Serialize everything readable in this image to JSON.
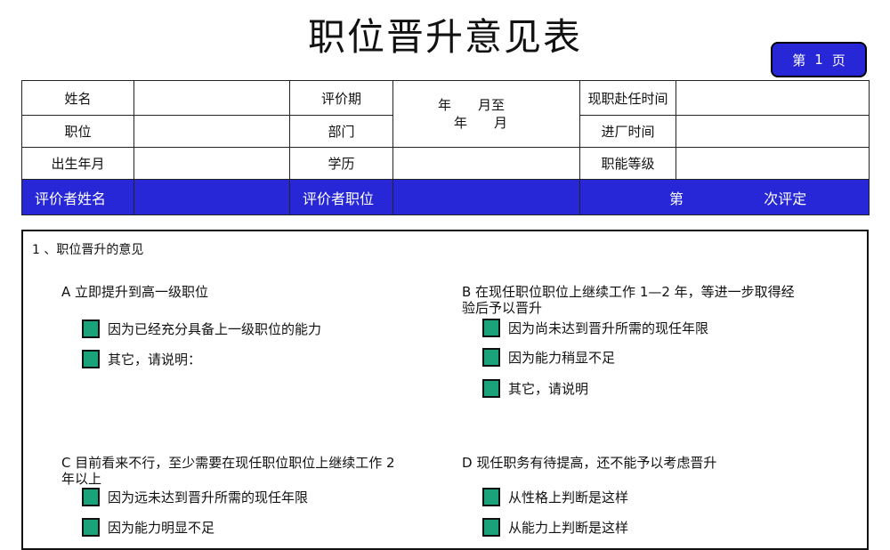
{
  "title": "职位晋升意见表",
  "page": {
    "prefix": "第",
    "number": "1",
    "suffix": "页"
  },
  "info": {
    "name_label": "姓名",
    "period_label": "评价期",
    "period_line1": "年　　月至",
    "period_line2": "年　　月",
    "current_since_label": "现职赴任时间",
    "position_label": "职位",
    "dept_label": "部门",
    "join_label": "进厂时间",
    "birth_label": "出生年月",
    "edu_label": "学历",
    "grade_label": "职能等级",
    "evaluator_name_label": "评价者姓名",
    "evaluator_pos_label": "评价者职位",
    "round_prefix": "第",
    "round_suffix": "次评定"
  },
  "section1": {
    "title": "1 、职位晋升的意见",
    "A": {
      "head": "A  立即提升到高一级职位",
      "items": [
        "因为已经充分具备上一级职位的能力",
        "其它，请说明："
      ]
    },
    "B": {
      "head_line1": "B  在现任职位职位上继续工作 1—2 年，等进一步取得经",
      "head_line2": "验后予以晋升",
      "items": [
        "因为尚未达到晋升所需的现任年限",
        "因为能力稍显不足",
        "其它，请说明"
      ]
    },
    "C": {
      "head_line1": "C  目前看来不行，至少需要在现任职位职位上继续工作 2",
      "head_line2": "年以上",
      "items": [
        "因为远未达到晋升所需的现任年限",
        "因为能力明显不足"
      ]
    },
    "D": {
      "head": "D  现任职务有待提高，还不能予以考虑晋升",
      "items": [
        "从性格上判断是这样",
        "从能力上判断是这样"
      ]
    }
  },
  "colors": {
    "accent_blue": "#2727d8",
    "checkbox_green": "#1aa37a"
  }
}
